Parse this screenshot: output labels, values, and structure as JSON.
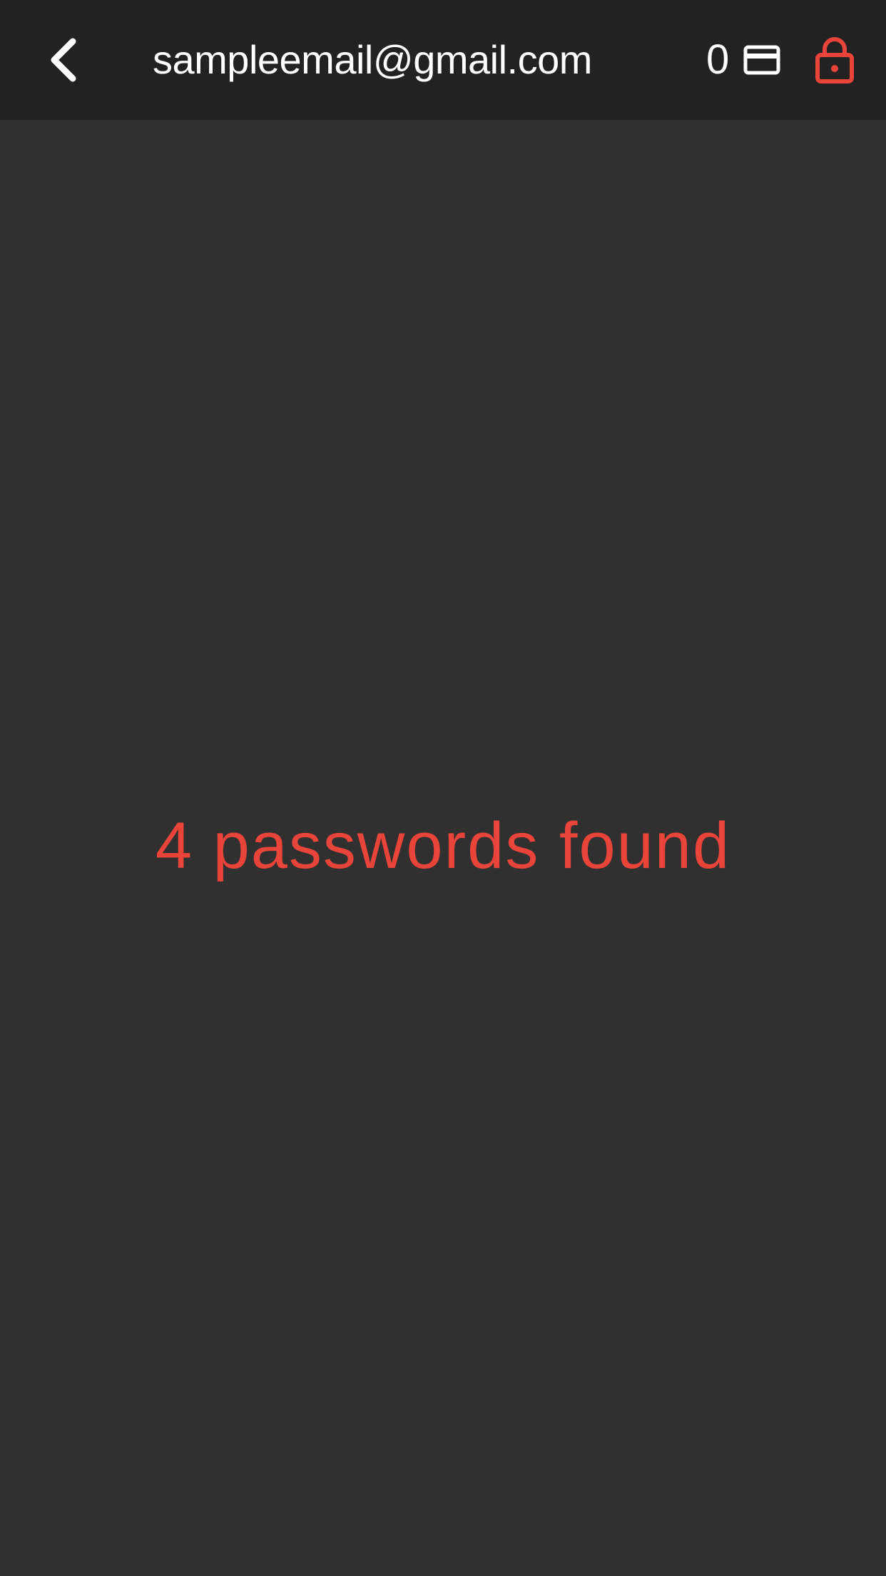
{
  "header": {
    "title": "sampleemail@gmail.com",
    "card_count": "0",
    "icons": {
      "back": "chevron-left-icon",
      "card": "credit-card-icon",
      "lock": "lock-icon"
    }
  },
  "main": {
    "status_text": "4 passwords found"
  },
  "colors": {
    "background": "#303030",
    "header_background": "#222222",
    "accent": "#e8443a",
    "text": "#ffffff"
  }
}
